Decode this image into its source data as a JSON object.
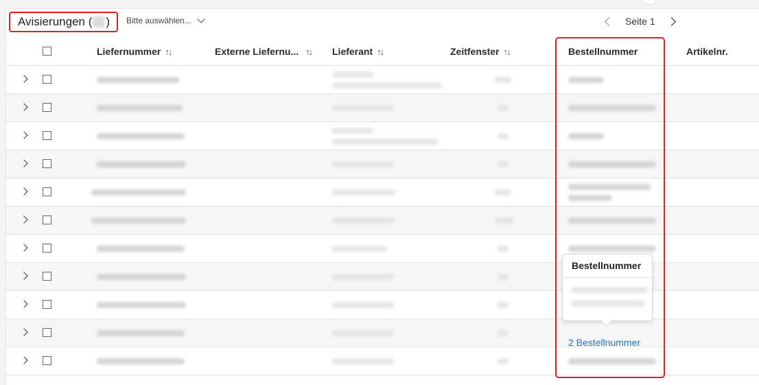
{
  "header": {
    "title": "Avisierungen (",
    "title_suffix": ")",
    "filter_placeholder": "Bitte auswählen...",
    "pager_label": "Seite 1"
  },
  "table": {
    "columns": [
      {
        "key": "liefernummer",
        "label": "Liefernummer",
        "sortable": true
      },
      {
        "key": "externe",
        "label": "Externe Liefernu...",
        "sortable": true
      },
      {
        "key": "lieferant",
        "label": "Lieferant",
        "sortable": true
      },
      {
        "key": "zeitfenster",
        "label": "Zeitfenster",
        "sortable": true
      },
      {
        "key": "bestellnummer",
        "label": "Bestellnummer",
        "sortable": false
      },
      {
        "key": "artikelnr",
        "label": "Artikelnr.",
        "sortable": false
      }
    ],
    "row_count": 11,
    "sort_icon": "↑↓"
  },
  "tooltip": {
    "title": "Bestellnummer"
  },
  "link": {
    "label": "2 Bestellnummer"
  },
  "colors": {
    "highlight": "#e02020",
    "link": "#1f74c9"
  }
}
